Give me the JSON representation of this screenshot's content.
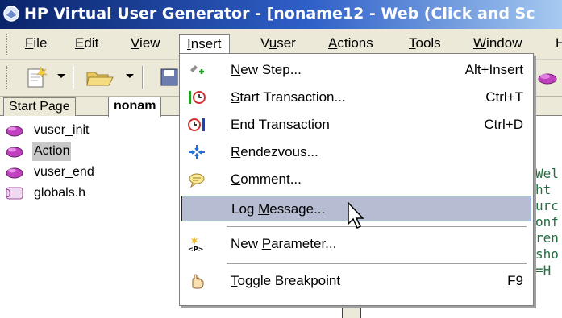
{
  "window": {
    "title": "HP Virtual User Generator - [noname12 - Web (Click and Sc"
  },
  "menubar": {
    "items": [
      {
        "pre": "",
        "key": "F",
        "post": "ile"
      },
      {
        "pre": "",
        "key": "E",
        "post": "dit"
      },
      {
        "pre": "",
        "key": "V",
        "post": "iew"
      },
      {
        "pre": "",
        "key": "I",
        "post": "nsert"
      },
      {
        "pre": "V",
        "key": "u",
        "post": "ser"
      },
      {
        "pre": "",
        "key": "A",
        "post": "ctions"
      },
      {
        "pre": "",
        "key": "T",
        "post": "ools"
      },
      {
        "pre": "",
        "key": "W",
        "post": "indow"
      },
      {
        "pre": "",
        "key": "",
        "post": "H"
      }
    ]
  },
  "tabs": {
    "start_page": "Start Page",
    "active": "nonam"
  },
  "tree": {
    "items": [
      {
        "label": "vuser_init",
        "icon": "script-icon"
      },
      {
        "label": "Action",
        "icon": "script-icon"
      },
      {
        "label": "vuser_end",
        "icon": "script-icon"
      },
      {
        "label": "globals.h",
        "icon": "header-file-icon"
      }
    ]
  },
  "insert_menu": {
    "items": [
      {
        "pre": "",
        "key": "N",
        "post": "ew Step...",
        "shortcut": "Alt+Insert",
        "icon": "new-step-icon"
      },
      {
        "pre": "",
        "key": "S",
        "post": "tart Transaction...",
        "shortcut": "Ctrl+T",
        "icon": "start-transaction-icon"
      },
      {
        "pre": "",
        "key": "E",
        "post": "nd Transaction",
        "shortcut": "Ctrl+D",
        "icon": "end-transaction-icon"
      },
      {
        "pre": "",
        "key": "R",
        "post": "endezvous...",
        "shortcut": "",
        "icon": "rendezvous-icon"
      },
      {
        "pre": "",
        "key": "C",
        "post": "omment...",
        "shortcut": "",
        "icon": "comment-icon"
      },
      {
        "pre": "Log ",
        "key": "M",
        "post": "essage...",
        "shortcut": "",
        "icon": ""
      },
      {
        "pre": "New ",
        "key": "P",
        "post": "arameter...",
        "shortcut": "",
        "icon": "parameter-icon"
      },
      {
        "pre": "",
        "key": "T",
        "post": "oggle Breakpoint",
        "shortcut": "F9",
        "icon": "breakpoint-icon"
      }
    ],
    "highlighted": "Log Message..."
  },
  "editor": {
    "lines": [
      "Wel",
      "ht",
      "urc",
      "onf",
      "ren",
      "sho",
      "=H"
    ]
  },
  "colors": {
    "title_start": "#0a246a",
    "menu_highlight": "#b6bdd2",
    "code_text": "#207040"
  }
}
